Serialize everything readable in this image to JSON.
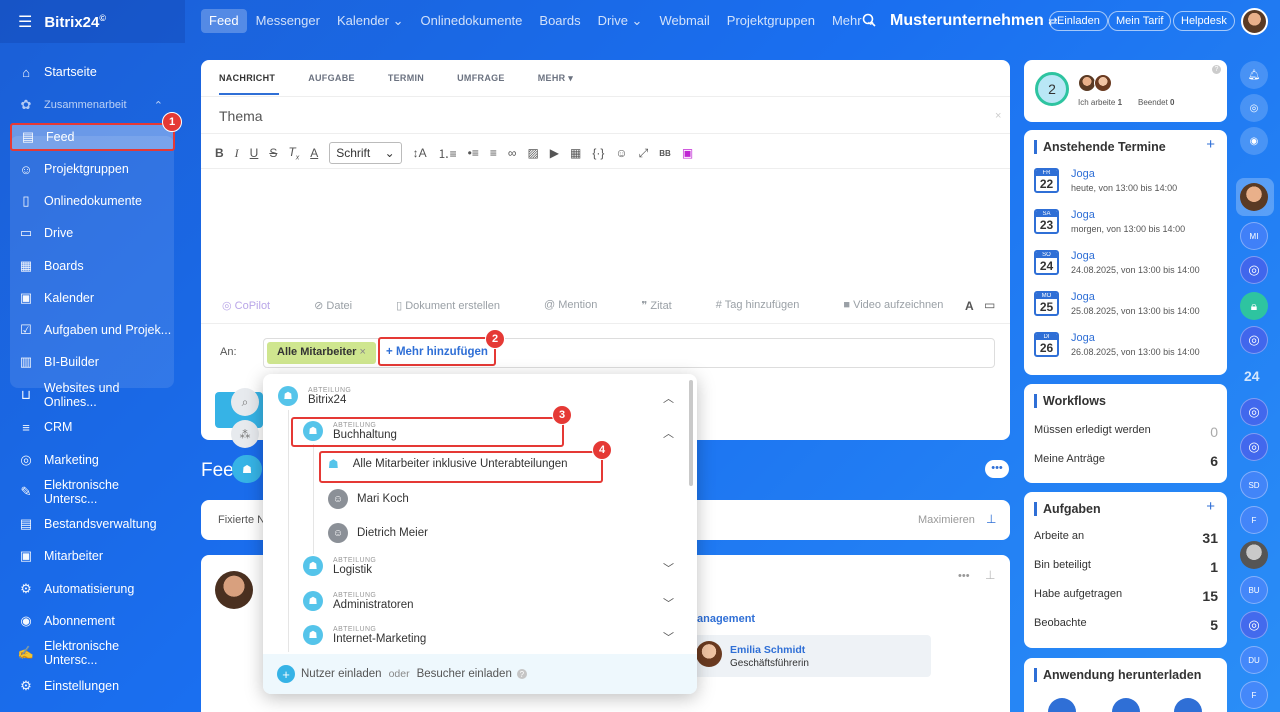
{
  "brand": {
    "name": "Bitrix24",
    "mark": "©"
  },
  "topnav": [
    "Feed",
    "Messenger",
    "Kalender ⌄",
    "Onlinedokumente",
    "Boards",
    "Drive ⌄",
    "Webmail",
    "Projektgruppen",
    "Mehr ⌄"
  ],
  "company": "Musterunternehmen",
  "topbuttons": {
    "invite": "Einladen",
    "plan": "Mein Tarif",
    "help": "Helpdesk"
  },
  "sidebar": {
    "items": [
      "Startseite",
      "Zusammenarbeit",
      "Feed",
      "Projektgruppen",
      "Onlinedokumente",
      "Drive",
      "Boards",
      "Kalender",
      "Aufgaben und Projek...",
      "BI-Builder",
      "Websites und Onlines...",
      "CRM",
      "Marketing",
      "Elektronische Untersc...",
      "Bestandsverwaltung",
      "Mitarbeiter",
      "Automatisierung",
      "Abonnement",
      "Elektronische Untersc...",
      "Einstellungen"
    ]
  },
  "editor": {
    "tabs": [
      "NACHRICHT",
      "AUFGABE",
      "TERMIN",
      "UMFRAGE",
      "MEHR ▾"
    ],
    "thema": "Thema",
    "font": "Schrift",
    "tools": [
      "CoPilot",
      "Datei",
      "Dokument erstellen",
      "Mention",
      "Zitat",
      "Tag hinzufügen",
      "Video aufzeichnen"
    ],
    "an_label": "An:",
    "all_chip": "Alle Mitarbeiter",
    "add_more": "+ Mehr hinzufügen"
  },
  "feed": {
    "title": "Fee",
    "pinned": "Fixierte N",
    "maximize": "Maximieren",
    "management": "anagement",
    "person_name": "Emilia Schmidt",
    "person_role": "Geschäftsführerin"
  },
  "dropdown": {
    "tag": "ABTEILUNG",
    "root": "Bitrix24",
    "sub": "Buchhaltung",
    "allsub": "Alle Mitarbeiter inklusive Unterabteilungen",
    "users": [
      "Mari Koch",
      "Dietrich Meier"
    ],
    "depts": [
      "Logistik",
      "Administratoren",
      "Internet-Marketing"
    ],
    "invite_users": "Nutzer einladen",
    "or": "oder",
    "invite_guests": "Besucher einladen"
  },
  "badges": [
    "1",
    "2",
    "3",
    "4"
  ],
  "status": {
    "count": "2",
    "working_label": "Ich arbeite",
    "working": "1",
    "done_label": "Beendet",
    "done": "0"
  },
  "events": {
    "title": "Anstehende Termine",
    "items": [
      {
        "day": "FR",
        "num": "22",
        "name": "Joga",
        "time": "heute, von 13:00 bis 14:00"
      },
      {
        "day": "SA",
        "num": "23",
        "name": "Joga",
        "time": "morgen, von 13:00 bis 14:00"
      },
      {
        "day": "SO",
        "num": "24",
        "name": "Joga",
        "time": "24.08.2025, von 13:00 bis 14:00"
      },
      {
        "day": "MO",
        "num": "25",
        "name": "Joga",
        "time": "25.08.2025, von 13:00 bis 14:00"
      },
      {
        "day": "DI",
        "num": "26",
        "name": "Joga",
        "time": "26.08.2025, von 13:00 bis 14:00"
      }
    ]
  },
  "workflows": {
    "title": "Workflows",
    "rows": [
      {
        "k": "Müssen erledigt werden",
        "v": "0"
      },
      {
        "k": "Meine Anträge",
        "v": "6"
      }
    ]
  },
  "tasks": {
    "title": "Aufgaben",
    "rows": [
      {
        "k": "Arbeite an",
        "v": "31"
      },
      {
        "k": "Bin beteiligt",
        "v": "1"
      },
      {
        "k": "Habe aufgetragen",
        "v": "15"
      },
      {
        "k": "Beobachte",
        "v": "5"
      }
    ]
  },
  "download": {
    "title": "Anwendung herunterladen"
  },
  "rail": {
    "num": "24",
    "avatars": [
      "MI",
      "SD",
      "F",
      "BU",
      "DU",
      "F"
    ]
  }
}
